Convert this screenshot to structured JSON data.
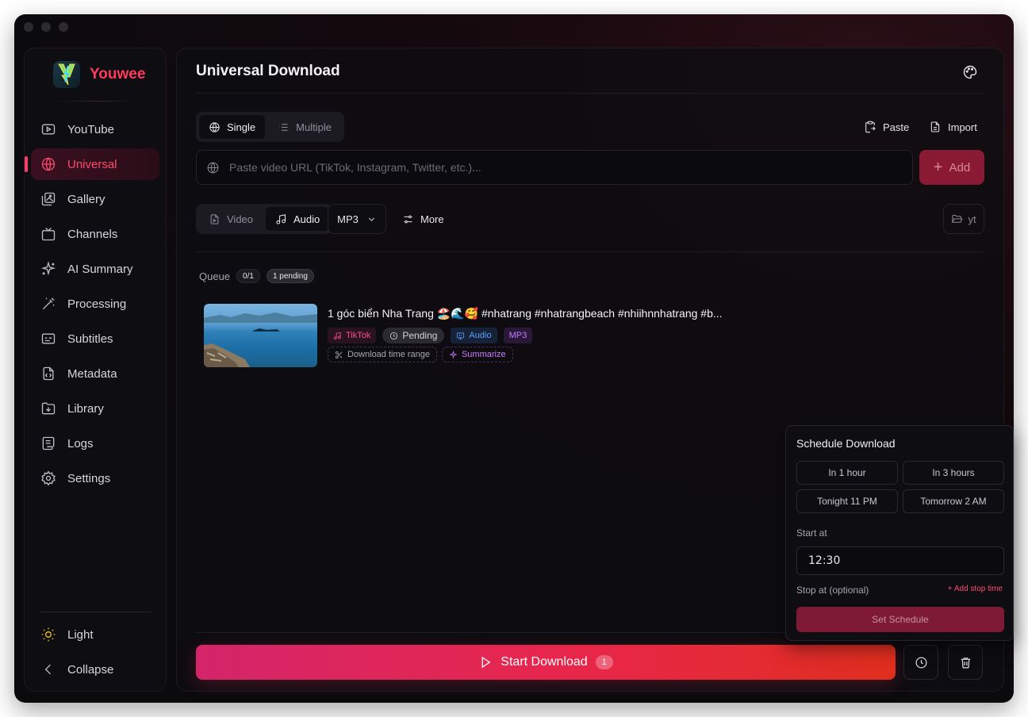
{
  "app": {
    "name": "Youwee"
  },
  "sidebar": {
    "items": [
      {
        "label": "YouTube",
        "icon": "youtube-icon"
      },
      {
        "label": "Universal",
        "icon": "globe-icon",
        "active": true
      },
      {
        "label": "Gallery",
        "icon": "gallery-icon"
      },
      {
        "label": "Channels",
        "icon": "tv-icon"
      },
      {
        "label": "AI Summary",
        "icon": "sparkles-icon"
      },
      {
        "label": "Processing",
        "icon": "wand-icon"
      },
      {
        "label": "Subtitles",
        "icon": "subtitles-icon"
      },
      {
        "label": "Metadata",
        "icon": "file-code-icon"
      },
      {
        "label": "Library",
        "icon": "folder-download-icon"
      },
      {
        "label": "Logs",
        "icon": "scroll-icon"
      },
      {
        "label": "Settings",
        "icon": "gear-icon"
      }
    ],
    "theme_toggle": "Light",
    "collapse": "Collapse"
  },
  "main": {
    "title": "Universal Download",
    "mode": {
      "single": "Single",
      "multiple": "Multiple",
      "selected": "Single"
    },
    "paste_label": "Paste",
    "import_label": "Import",
    "url_input": {
      "value": "",
      "placeholder": "Paste video URL (TikTok, Instagram, Twitter, etc.)..."
    },
    "add_label": "Add",
    "media": {
      "video": "Video",
      "audio": "Audio",
      "selected": "Audio"
    },
    "format": "MP3",
    "more_label": "More",
    "folder_label": "yt",
    "queue": {
      "label": "Queue",
      "count": "0/1",
      "pending": "1 pending"
    },
    "items": [
      {
        "title": "1 góc biển Nha Trang 🏖️🌊🥰 #nhatrang #nhatrangbeach #nhiihnnhatrang #b...",
        "source": "TikTok",
        "status": "Pending",
        "type": "Audio",
        "format": "MP3",
        "time_range_label": "Download time range",
        "summarize_label": "Summarize"
      }
    ],
    "start_label": "Start Download",
    "start_count": "1"
  },
  "schedule": {
    "title": "Schedule Download",
    "presets": [
      "In 1 hour",
      "In 3 hours",
      "Tonight 11 PM",
      "Tomorrow 2 AM"
    ],
    "start_label": "Start at",
    "start_value": "12:30",
    "stop_label": "Stop at (optional)",
    "add_stop_label": "+ Add stop time",
    "set_label": "Set Schedule"
  },
  "colors": {
    "accent": "#ff3b5c",
    "tiktok": "#ff4f8a",
    "audio": "#5b9dff",
    "mp3": "#c17bff"
  }
}
